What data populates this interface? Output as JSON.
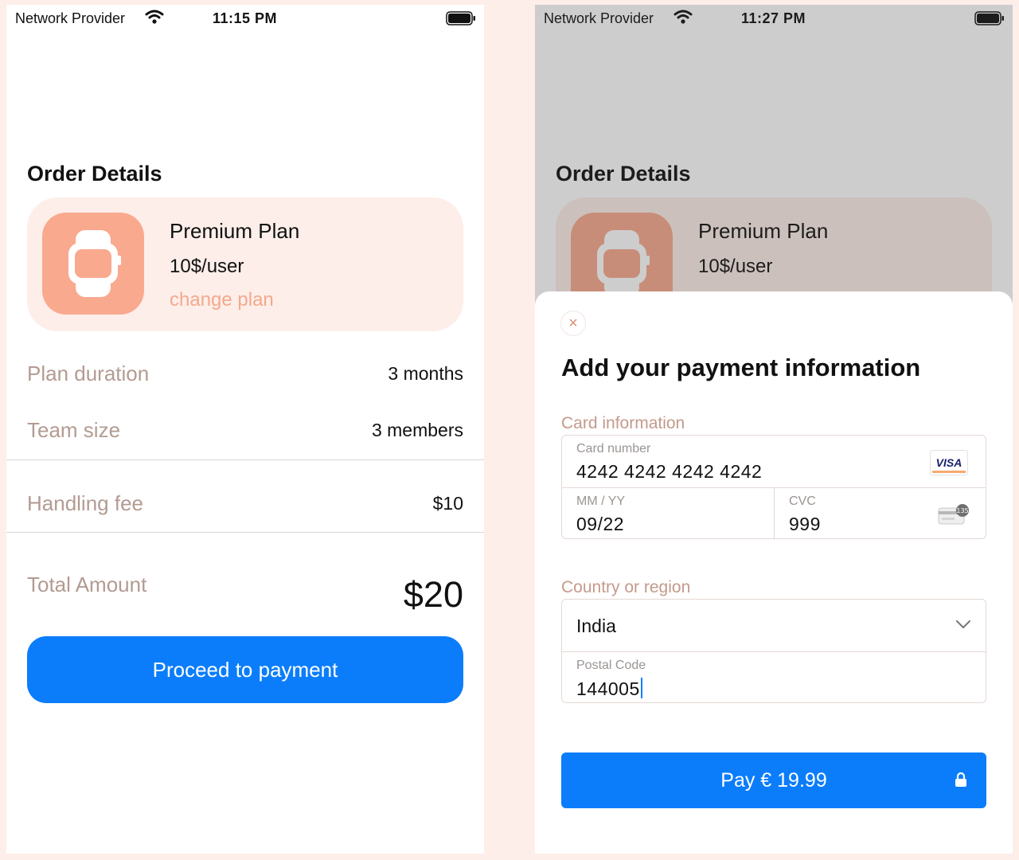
{
  "left_screen": {
    "status_bar": {
      "carrier": "Network Provider",
      "time": "11:15 PM"
    },
    "section_title": "Order Details",
    "plan": {
      "name": "Premium Plan",
      "price": "10$/user",
      "change_link": "change plan"
    },
    "rows": [
      {
        "label": "Plan duration",
        "value": "3 months"
      },
      {
        "label": "Team size",
        "value": "3 members"
      },
      {
        "label": "Handling fee",
        "value": "$10"
      },
      {
        "label": "Total Amount",
        "value": "$20"
      }
    ],
    "proceed_button": "Proceed to payment"
  },
  "right_screen": {
    "status_bar": {
      "carrier": "Network Provider",
      "time": "11:27 PM"
    },
    "section_title": "Order Details",
    "plan": {
      "name": "Premium Plan",
      "price": "10$/user"
    },
    "sheet": {
      "close_glyph": "×",
      "title": "Add your payment information",
      "card_information_label": "Card information",
      "card_number": {
        "label": "Card number",
        "value": "4242 4242 4242 4242",
        "brand": "VISA"
      },
      "expiry": {
        "label": "MM / YY",
        "value": "09/22"
      },
      "cvc": {
        "label": "CVC",
        "value": "999",
        "icon_text": "135"
      },
      "country_label": "Country or region",
      "country_value": "India",
      "postal_code": {
        "label": "Postal Code",
        "value": "144005"
      },
      "pay_button": "Pay € 19.99"
    }
  },
  "colors": {
    "accent_blue": "#0b7dfb",
    "peach": "#f9a98e",
    "card_bg": "#fdeee9",
    "muted_label": "#b39b92"
  },
  "icons": [
    "wifi-icon",
    "battery-icon",
    "watch-icon",
    "close-icon",
    "visa-icon",
    "cvc-card-icon",
    "chevron-down-icon",
    "lock-icon"
  ]
}
